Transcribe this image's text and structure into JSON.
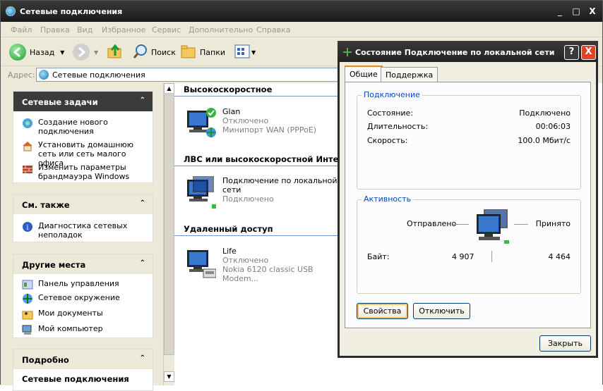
{
  "window": {
    "title": "Сетевые подключения",
    "controls": {
      "minimize": "_",
      "maximize": "□",
      "close": "X"
    }
  },
  "menu": [
    "Файл",
    "Правка",
    "Вид",
    "Избранное",
    "Сервис",
    "Дополнительно",
    "Справка"
  ],
  "toolbar": {
    "back": "Назад",
    "search": "Поиск",
    "folders": "Папки"
  },
  "address": {
    "label": "Адрес:",
    "value": "Сетевые подключения"
  },
  "left": {
    "tasks": {
      "title": "Сетевые задачи",
      "items": [
        "Создание нового подключения",
        "Установить домашнюю сеть или сеть малого офиса",
        "Изменить параметры брандмауэра Windows"
      ]
    },
    "see_also": {
      "title": "См. также",
      "items": [
        "Диагностика сетевых неполадок"
      ]
    },
    "other": {
      "title": "Другие места",
      "items": [
        "Панель управления",
        "Сетевое окружение",
        "Мои документы",
        "Мой компьютер"
      ]
    },
    "details": {
      "title": "Подробно",
      "sub": "Сетевые подключения"
    }
  },
  "groups": [
    {
      "title": "Высокоскоростное",
      "conn": {
        "name": "Glan",
        "status": "Отключено",
        "device": "Минипорт WAN (PPPoE)"
      }
    },
    {
      "title": "ЛВС или высокоскоростной Интернет",
      "conn": {
        "name": "Подключение по локальной сети",
        "status": "Подключено",
        "device": ""
      }
    },
    {
      "title": "Удаленный доступ",
      "conn": {
        "name": "Life",
        "status": "Отключено",
        "device": "Nokia 6120 classic USB Modem..."
      }
    }
  ],
  "dialog": {
    "title": "Состояние Подключение по локальной сети",
    "help": "?",
    "close": "X",
    "tabs": [
      "Общие",
      "Поддержка"
    ],
    "connection": {
      "legend": "Подключение",
      "rows": [
        {
          "label": "Состояние:",
          "value": "Подключено"
        },
        {
          "label": "Длительность:",
          "value": "00:06:03"
        },
        {
          "label": "Скорость:",
          "value": "100.0 Мбит/с"
        }
      ]
    },
    "activity": {
      "legend": "Активность",
      "sent_label": "Отправлено",
      "recv_label": "Принято",
      "bytes_label": "Байт:",
      "sent": "4 907",
      "recv": "4 464"
    },
    "buttons": {
      "properties": "Свойства",
      "disconnect": "Отключить",
      "close": "Закрыть"
    }
  },
  "colors": {
    "accent": "#0046d5",
    "tab_highlight": "#e68b2c",
    "group_line": "#7a96c8"
  }
}
